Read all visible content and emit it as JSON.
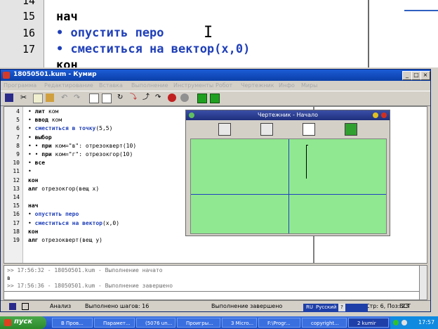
{
  "zoom": {
    "lines": [
      {
        "num": "14",
        "text": ""
      },
      {
        "num": "15",
        "text": "нач"
      },
      {
        "num": "16",
        "text": "• опустить перо"
      },
      {
        "num": "17",
        "text": "• сместиться на вектор(x,0)"
      },
      {
        "num": "",
        "text": "кон"
      }
    ],
    "cursor_glyph": "I"
  },
  "window": {
    "title": "18050501.kum - Кумир",
    "menu": [
      "Программа",
      "Редактирование",
      "Вставка",
      "Выполнение",
      "Инструменты",
      "Робот",
      "Чертежник",
      "Инфо",
      "Миры"
    ]
  },
  "editor": {
    "lines": [
      {
        "num": "4",
        "p1": "• ",
        "kw": "лит",
        "rest": " ком"
      },
      {
        "num": "5",
        "p1": "• ",
        "kw": "ввод",
        "rest": " ком"
      },
      {
        "num": "6",
        "p1": "• ",
        "kw": "сместиться в точку",
        "rest": "(5,5)"
      },
      {
        "num": "7",
        "p1": "• ",
        "kw": "выбор",
        "rest": ""
      },
      {
        "num": "8",
        "p1": "• • ",
        "kw": "при",
        "rest": " ком=\"в\": отрезокверт(10)"
      },
      {
        "num": "9",
        "p1": "• • ",
        "kw": "при",
        "rest": " ком=\"г\": отрезокгор(10)"
      },
      {
        "num": "10",
        "p1": "• ",
        "kw": "все",
        "rest": ""
      },
      {
        "num": "11",
        "p1": "• ",
        "kw": "",
        "rest": ""
      },
      {
        "num": "12",
        "p1": "",
        "kw": "кон",
        "rest": ""
      },
      {
        "num": "13",
        "p1": "",
        "kw": "алг",
        "rest": " отрезокгор(вещ x)"
      },
      {
        "num": "14",
        "p1": "",
        "kw": "",
        "rest": ""
      },
      {
        "num": "15",
        "p1": "",
        "kw": "нач",
        "rest": ""
      },
      {
        "num": "16",
        "p1": "• ",
        "kw": "опустить перо",
        "rest": ""
      },
      {
        "num": "17",
        "p1": "• ",
        "kw": "сместиться на вектор",
        "rest": "(x,0)"
      },
      {
        "num": "18",
        "p1": "",
        "kw": "кон",
        "rest": ""
      },
      {
        "num": "19",
        "p1": "",
        "kw": "алг",
        "rest": " отрезокверт(вещ y)"
      }
    ]
  },
  "drawer": {
    "title": "Чертежник - Начало"
  },
  "log": [
    ">> 17:56:32 - 18050501.kum - Выполнение начато",
    "в",
    ">> 17:56:36 - 18050501.kum - Выполнение завершено"
  ],
  "status": {
    "mode": "Анализ",
    "steps": "Выполнено шагов: 16",
    "state": "Выполнение завершено",
    "position": "Стр: 6, Поз: 23",
    "insert": "ВСТ"
  },
  "langbar": {
    "lang": "Русский",
    "code": "RU"
  },
  "taskbar": {
    "start": "пуск",
    "tasks": [
      "В Пров...",
      "Парамет...",
      "(5076 un...",
      "Проигры...",
      "3 Micro...",
      "F:\\Progr...",
      "copyright...",
      "2 kumir"
    ],
    "clock": "17:57"
  }
}
